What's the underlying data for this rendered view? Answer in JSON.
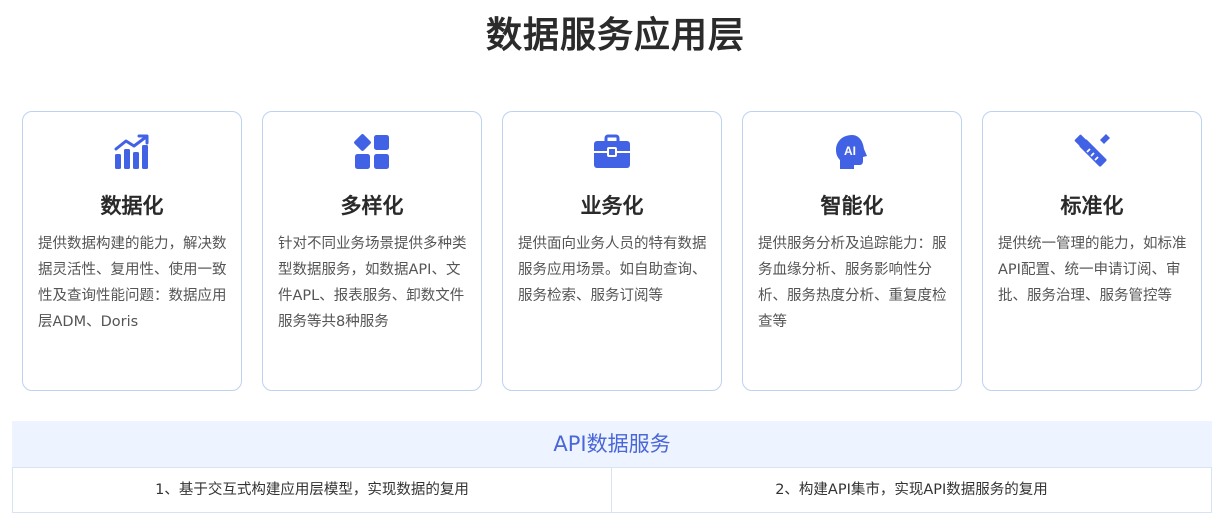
{
  "page": {
    "title": "数据服务应用层"
  },
  "colors": {
    "accent": "#4a66d8",
    "icon": "#4262e6",
    "card_border": "#bcd2ef",
    "header_bg": "#edf4ff"
  },
  "cards": [
    {
      "icon": "bar-chart-trend-icon",
      "title": "数据化",
      "desc": "提供数据构建的能力，解决数据灵活性、复用性、使用一致性及查询性能问题：数据应用层ADM、Doris"
    },
    {
      "icon": "grid-blocks-icon",
      "title": "多样化",
      "desc": "针对不同业务场景提供多种类型数据服务，如数据API、文件APL、报表服务、卸数文件服务等共8种服务"
    },
    {
      "icon": "briefcase-icon",
      "title": "业务化",
      "desc": "提供面向业务人员的特有数据服务应用场景。如自助查询、服务检索、服务订阅等"
    },
    {
      "icon": "ai-head-icon",
      "title": "智能化",
      "desc": "提供服务分析及追踪能力：服务血缘分析、服务影响性分析、服务热度分析、重复度检查等",
      "icon_text": "AI"
    },
    {
      "icon": "ruler-pencil-icon",
      "title": "标准化",
      "desc": "提供统一管理的能力，如标准API配置、统一申请订阅、审批、服务治理、服务管控等"
    }
  ],
  "api": {
    "title": "API数据服务",
    "items": [
      "1、基于交互式构建应用层模型，实现数据的复用",
      "2、构建API集市，实现API数据服务的复用"
    ]
  }
}
